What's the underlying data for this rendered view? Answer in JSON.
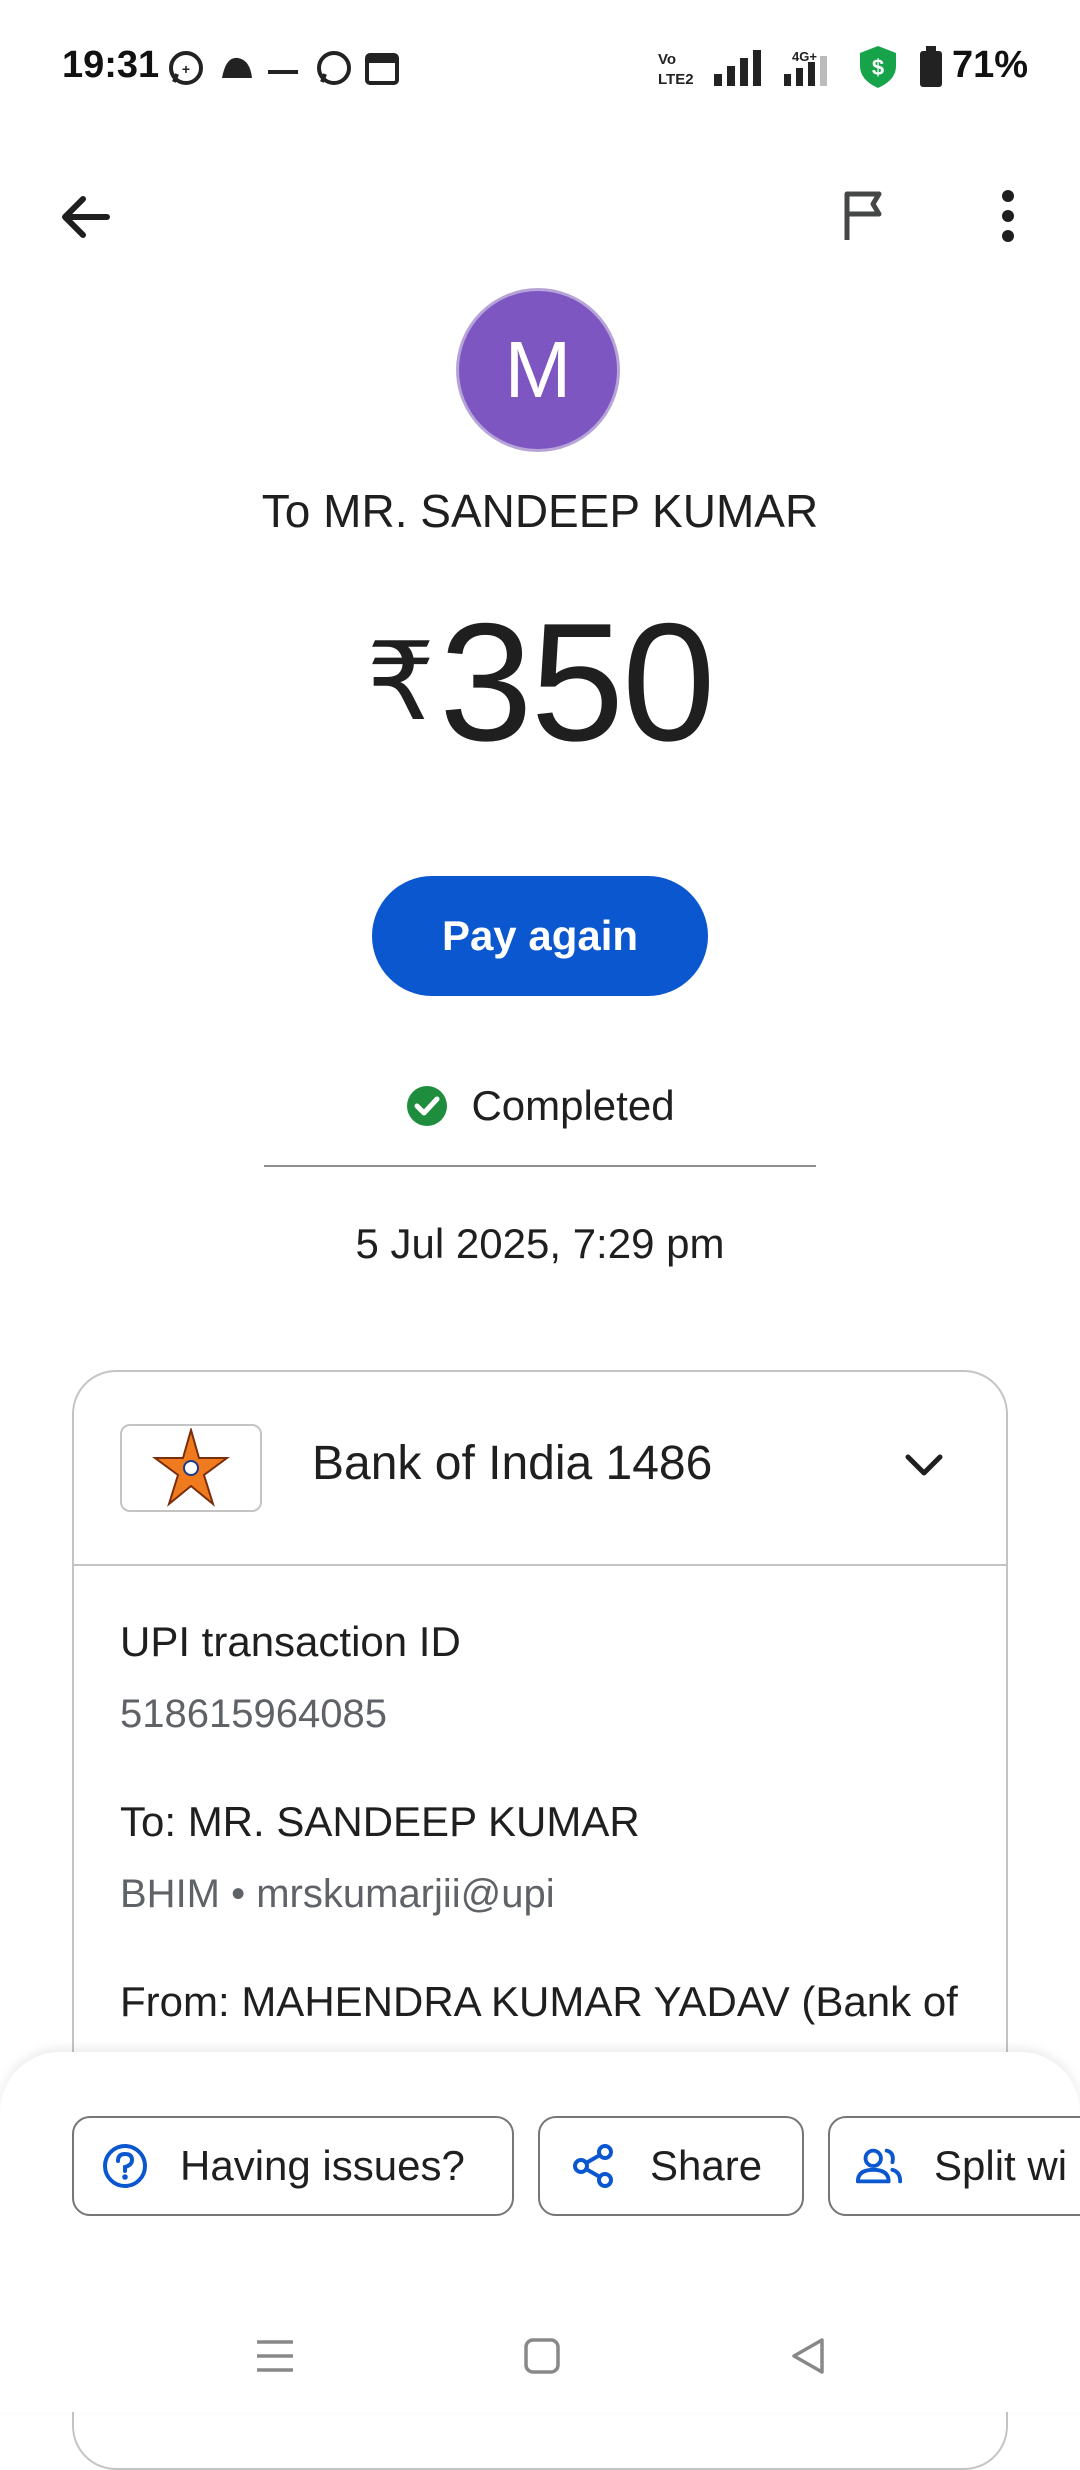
{
  "status_bar": {
    "time": "19:31",
    "battery_percent": "71%",
    "network_label_1": "Vo LTE2",
    "network_label_2": "4G+"
  },
  "top_bar": {
    "back_icon": "arrow-back-icon",
    "flag_icon": "flag-icon",
    "more_icon": "more-vert-icon"
  },
  "recipient": {
    "avatar_letter": "M",
    "avatar_color": "#7d56c1",
    "line": "To MR. SANDEEP  KUMAR"
  },
  "amount": {
    "currency": "₹",
    "value": "350"
  },
  "pay_again_label": "Pay again",
  "status": {
    "label": "Completed",
    "color": "#1e8e3e"
  },
  "datetime": "5 Jul 2025, 7:29 pm",
  "card": {
    "bank_name": "Bank of India 1486",
    "details": [
      {
        "title": "UPI transaction ID",
        "value": "518615964085"
      },
      {
        "title": "To: MR. SANDEEP  KUMAR",
        "value": "BHIM • mrskumarjii@upi"
      },
      {
        "title": "From: MAHENDRA KUMAR YADAV (Bank of"
      }
    ]
  },
  "actions": {
    "issues": "Having issues?",
    "share": "Share",
    "split": "Split wi"
  },
  "accent_color": "#0b57d0"
}
